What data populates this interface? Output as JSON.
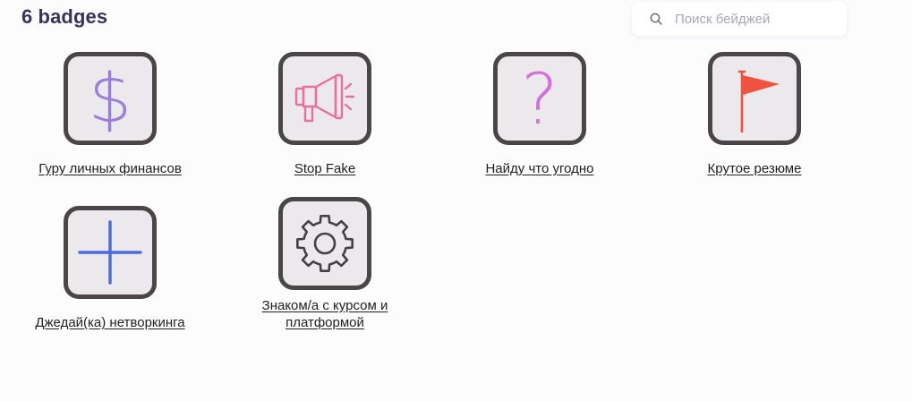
{
  "header": {
    "title": "6 badges"
  },
  "search": {
    "placeholder": "Поиск бейджей",
    "value": ""
  },
  "badges": [
    {
      "label": "Гуру личных финансов",
      "icon": "dollar-icon",
      "color": "#9b7ddb"
    },
    {
      "label": "Stop Fake",
      "icon": "megaphone-icon",
      "color": "#e8709a"
    },
    {
      "label": "Найду что угодно",
      "icon": "question-icon",
      "color": "#d26fdc"
    },
    {
      "label": "Крутое резюме",
      "icon": "flag-icon",
      "color": "#ef5340"
    },
    {
      "label": "Джедай(ка) нетворкинга",
      "icon": "plus-icon",
      "color": "#4b6bdc"
    },
    {
      "label": "Знаком/а с курсом и платформой",
      "icon": "gear-icon",
      "color": "#444044"
    }
  ]
}
